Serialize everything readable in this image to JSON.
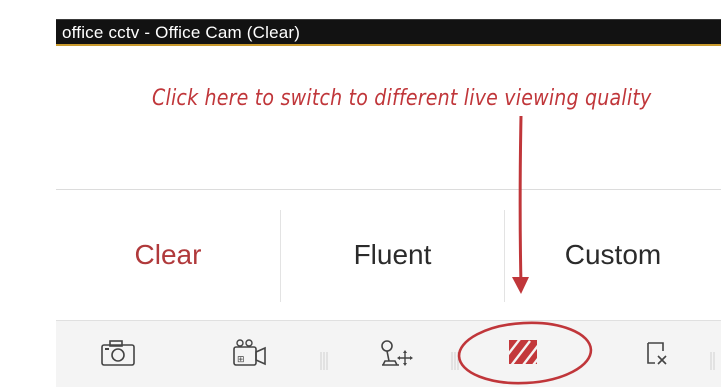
{
  "window": {
    "title": "office cctv - Office Cam (Clear)"
  },
  "annotation": {
    "text": "Click here to switch to different live viewing quality"
  },
  "quality_options": [
    {
      "label": "Clear",
      "selected": true
    },
    {
      "label": "Fluent",
      "selected": false
    },
    {
      "label": "Custom",
      "selected": false
    }
  ],
  "toolbar": {
    "tools": [
      "camera-icon",
      "video-record-icon",
      "ptz-control-icon",
      "quality-icon",
      "close-window-icon"
    ]
  },
  "colors": {
    "accent": "#b0393b",
    "annotation": "#c0363a",
    "title_bar": "#121212"
  }
}
